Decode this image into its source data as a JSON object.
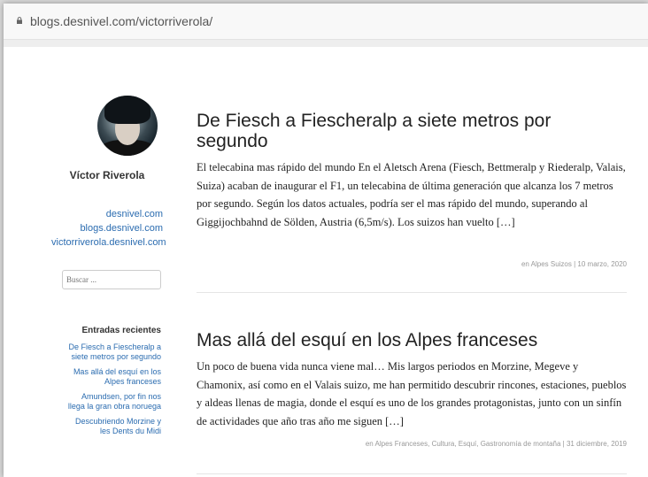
{
  "browser": {
    "url": "blogs.desnivel.com/victorriverola/"
  },
  "sidebar": {
    "author": "Víctor Riverola",
    "links": [
      "desnivel.com",
      "blogs.desnivel.com",
      "victorriverola.desnivel.com"
    ],
    "search_placeholder": "Buscar ...",
    "recent_title": "Entradas recientes",
    "recent": [
      "De Fiesch a Fiescheralp a siete metros por segundo",
      "Mas allá del esquí en los Alpes franceses",
      "Amundsen, por fin nos llega la gran obra noruega",
      "Descubriendo Morzine y les Dents du Midi"
    ]
  },
  "posts": [
    {
      "title": "De Fiesch a Fiescheralp a siete metros por segundo",
      "excerpt": "El telecabina mas rápido del mundo En el Aletsch Arena (Fiesch, Bettmeralp y Riederalp, Valais, Suiza) acaban de inaugurar el F1, un telecabina de última generación que alcanza los 7 metros por segundo. Según los datos actuales, podría ser el mas rápido del mundo, superando al Giggijochbahnd de Sölden, Austria (6,5m/s). Los suizos han vuelto […]",
      "meta": "en Alpes Suizos | 10 marzo, 2020"
    },
    {
      "title": "Mas allá del esquí en los Alpes franceses",
      "excerpt": "Un poco de buena vida nunca viene mal… Mis largos periodos en Morzine, Megeve y Chamonix, así como en el Valais suizo, me han permitido descubrir rincones, estaciones, pueblos y aldeas llenas de magia, donde el esquí es uno de los grandes protagonistas, junto con un sinfín de actividades que año tras año me siguen […]",
      "meta": "en Alpes Franceses, Cultura, Esquí, Gastronomía de montaña | 31 diciembre, 2019"
    }
  ]
}
